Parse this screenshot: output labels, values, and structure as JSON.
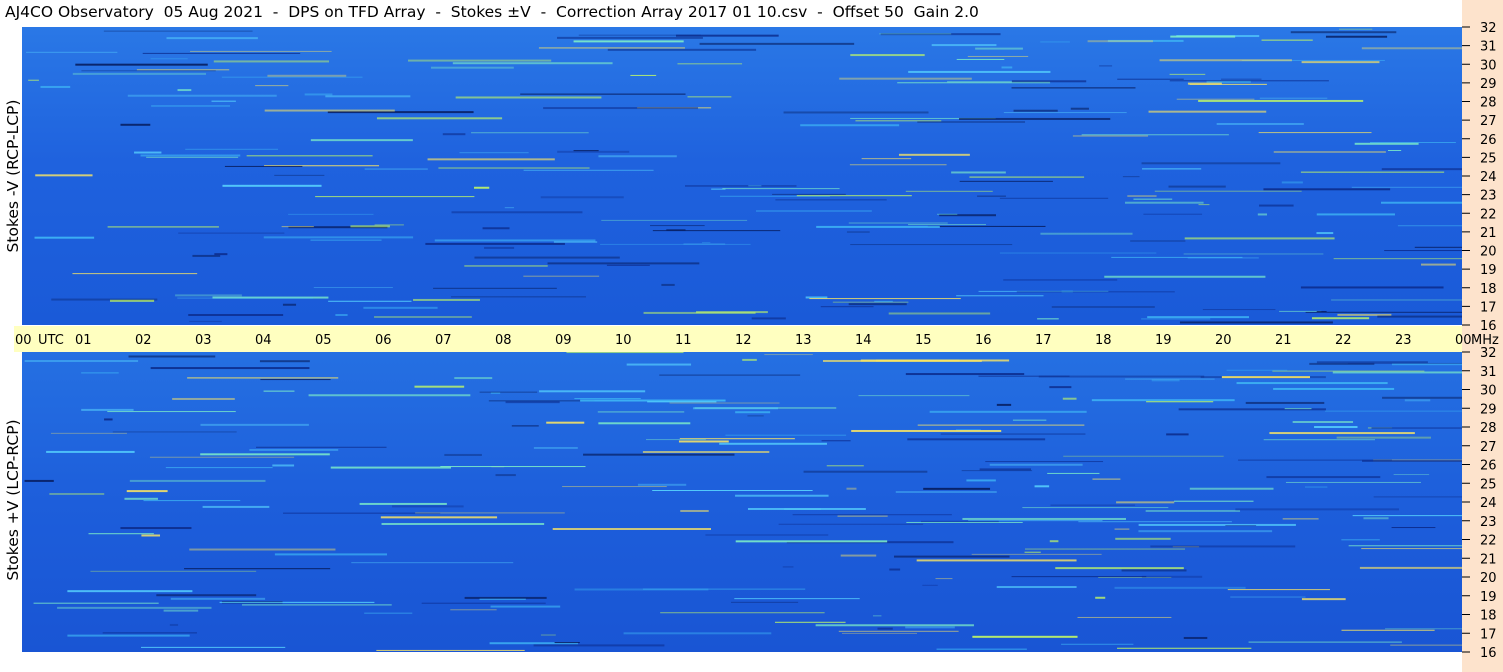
{
  "title": "AJ4CO Observatory  05 Aug 2021  -  DPS on TFD Array  -  Stokes ±V  -  Correction Array 2017 01 10.csv  -  Offset 50  Gain 2.0",
  "chart_data": {
    "type": "heatmap",
    "panels": [
      {
        "ylabel": "Stokes -V (RCP-LCP)",
        "y_ticks": [
          "32",
          "31",
          "30",
          "29",
          "28",
          "27",
          "26",
          "25",
          "24",
          "23",
          "22",
          "21",
          "20",
          "19",
          "18",
          "17",
          "16"
        ],
        "ylim": [
          16,
          32
        ]
      },
      {
        "ylabel": "Stokes +V (LCP-RCP)",
        "y_ticks": [
          "32",
          "31",
          "30",
          "29",
          "28",
          "27",
          "26",
          "25",
          "24",
          "23",
          "22",
          "21",
          "20",
          "19",
          "18",
          "17",
          "16"
        ],
        "ylim": [
          16,
          32
        ]
      }
    ],
    "x_ticks": [
      "00",
      "01",
      "02",
      "03",
      "04",
      "05",
      "06",
      "07",
      "08",
      "09",
      "10",
      "11",
      "12",
      "13",
      "14",
      "15",
      "16",
      "17",
      "18",
      "19",
      "20",
      "21",
      "22",
      "23",
      "00"
    ],
    "x_unit_label": "UTC",
    "y_unit_label": "MHz",
    "xlim": [
      0,
      24
    ],
    "colors": {
      "background": "#1e63e0",
      "strip": "#fde3cc",
      "utc_bar": "#ffffc0"
    }
  }
}
